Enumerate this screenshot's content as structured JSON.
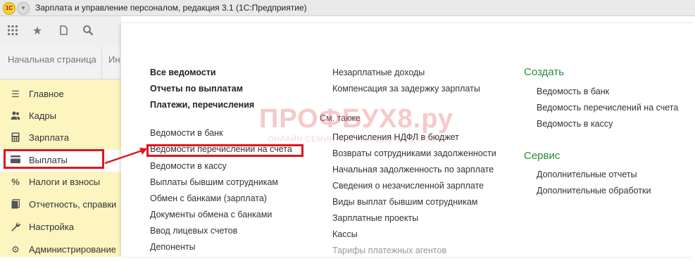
{
  "window": {
    "title": "Зарплата и управление персоналом, редакция 3.1  (1С:Предприятие)",
    "logo_text": "1С"
  },
  "toolbar": {
    "icons": [
      "apps-grid-icon",
      "star-icon",
      "history-icon",
      "search-icon"
    ]
  },
  "tabs": [
    {
      "label": "Начальная страница"
    },
    {
      "label": "Ин"
    }
  ],
  "sidebar": {
    "items": [
      {
        "label": "Главное",
        "icon": "menu-lines-icon"
      },
      {
        "label": "Кадры",
        "icon": "people-icon"
      },
      {
        "label": "Зарплата",
        "icon": "calculator-icon"
      },
      {
        "label": "Выплаты",
        "icon": "card-icon",
        "active": true
      },
      {
        "label": "Налоги и взносы",
        "icon": "percent-icon"
      },
      {
        "label": "Отчетность, справки",
        "icon": "report-icon"
      },
      {
        "label": "Настройка",
        "icon": "wrench-icon"
      },
      {
        "label": "Администрирование",
        "icon": "gear-icon"
      }
    ]
  },
  "main": {
    "col1_bold": [
      "Все ведомости",
      "Отчеты по выплатам",
      "Платежи, перечисления"
    ],
    "col1": [
      "Ведомости в банк",
      "Ведомости перечислений на счета",
      "Ведомости в кассу",
      "Выплаты бывшим сотрудникам",
      "Обмен с банками (зарплата)",
      "Документы обмена с банками",
      "Ввод лицевых счетов",
      "Депоненты"
    ],
    "col2_top": [
      "Незарплатные доходы",
      "Компенсация за задержку зарплаты"
    ],
    "see_also_label": "См. также",
    "col2": [
      "Перечисления НДФЛ в бюджет",
      "Возвраты сотрудниками задолженности",
      "Начальная задолженность по зарплате",
      "Сведения о незачисленной зарплате",
      "Виды выплат бывшим сотрудникам",
      "Зарплатные проекты",
      "Кассы",
      "Тарифы платежных агентов"
    ],
    "create": {
      "title": "Создать",
      "items": [
        "Ведомость в банк",
        "Ведомость перечислений на счета",
        "Ведомость в кассу"
      ]
    },
    "service": {
      "title": "Сервис",
      "items": [
        "Дополнительные отчеты",
        "Дополнительные обработки"
      ]
    }
  },
  "watermark": {
    "title": "ПРОФБУХ8.ру",
    "subtitle": "ОНЛАЙН СЕМИНАРЫ И ВИДЕОКУРСЫ 1С:8"
  },
  "colors": {
    "sidebar_bg": "#fdf5c0",
    "highlight": "#e0151f",
    "section_head": "#2a8a3a"
  }
}
